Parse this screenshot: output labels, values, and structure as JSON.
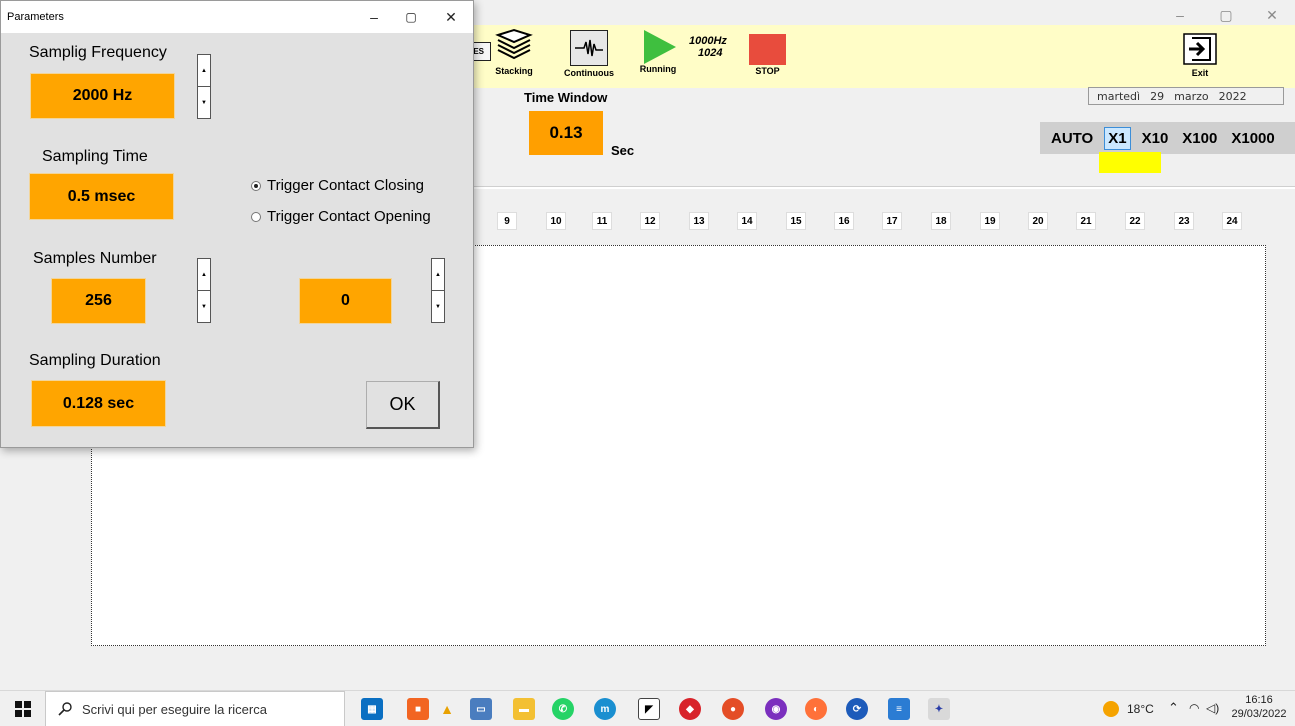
{
  "main_window": {
    "caption": {
      "minimize": "–",
      "maximize": "▢",
      "close": "✕"
    },
    "toolbar": {
      "partial_button": "ES",
      "stacking": "Stacking",
      "continuous": "Continuous",
      "running": "Running",
      "rate": "1000Hz",
      "samples": "1024",
      "stop": "STOP",
      "exit": "Exit"
    },
    "date": {
      "weekday": "martedì",
      "day": "29",
      "month": "marzo",
      "year": "2022"
    },
    "time_window": {
      "label": "Time Window",
      "value": "0.13",
      "unit": "Sec"
    },
    "scale": {
      "options": [
        "AUTO",
        "X1",
        "X10",
        "X100",
        "X1000"
      ],
      "selected": "X1"
    },
    "channels": [
      "9",
      "10",
      "11",
      "12",
      "13",
      "14",
      "15",
      "16",
      "17",
      "18",
      "19",
      "20",
      "21",
      "22",
      "23",
      "24"
    ]
  },
  "dialog": {
    "title": "Parameters",
    "caption": {
      "minimize": "–",
      "maximize": "▢",
      "close": "✕"
    },
    "sampling_frequency": {
      "label": "Samplig Frequency",
      "value": "2000 Hz"
    },
    "sampling_time": {
      "label": "Sampling Time",
      "value": "0.5 msec"
    },
    "trigger": {
      "closing": "Trigger Contact Closing",
      "opening": "Trigger Contact Opening",
      "selected": "closing"
    },
    "samples_number": {
      "label": "Samples Number",
      "value": "256"
    },
    "offset": {
      "value": "0"
    },
    "sampling_duration": {
      "label": "Sampling Duration",
      "value": "0.128 sec"
    },
    "ok": "OK"
  },
  "taskbar": {
    "search_placeholder": "Scrivi qui per eseguire la ricerca",
    "weather": "18°C",
    "time": "16:16",
    "date": "29/03/2022"
  },
  "colors": {
    "value_box": "#ffa500",
    "toolbar": "#fffdc7",
    "scale_highlight": "#ffff00"
  }
}
